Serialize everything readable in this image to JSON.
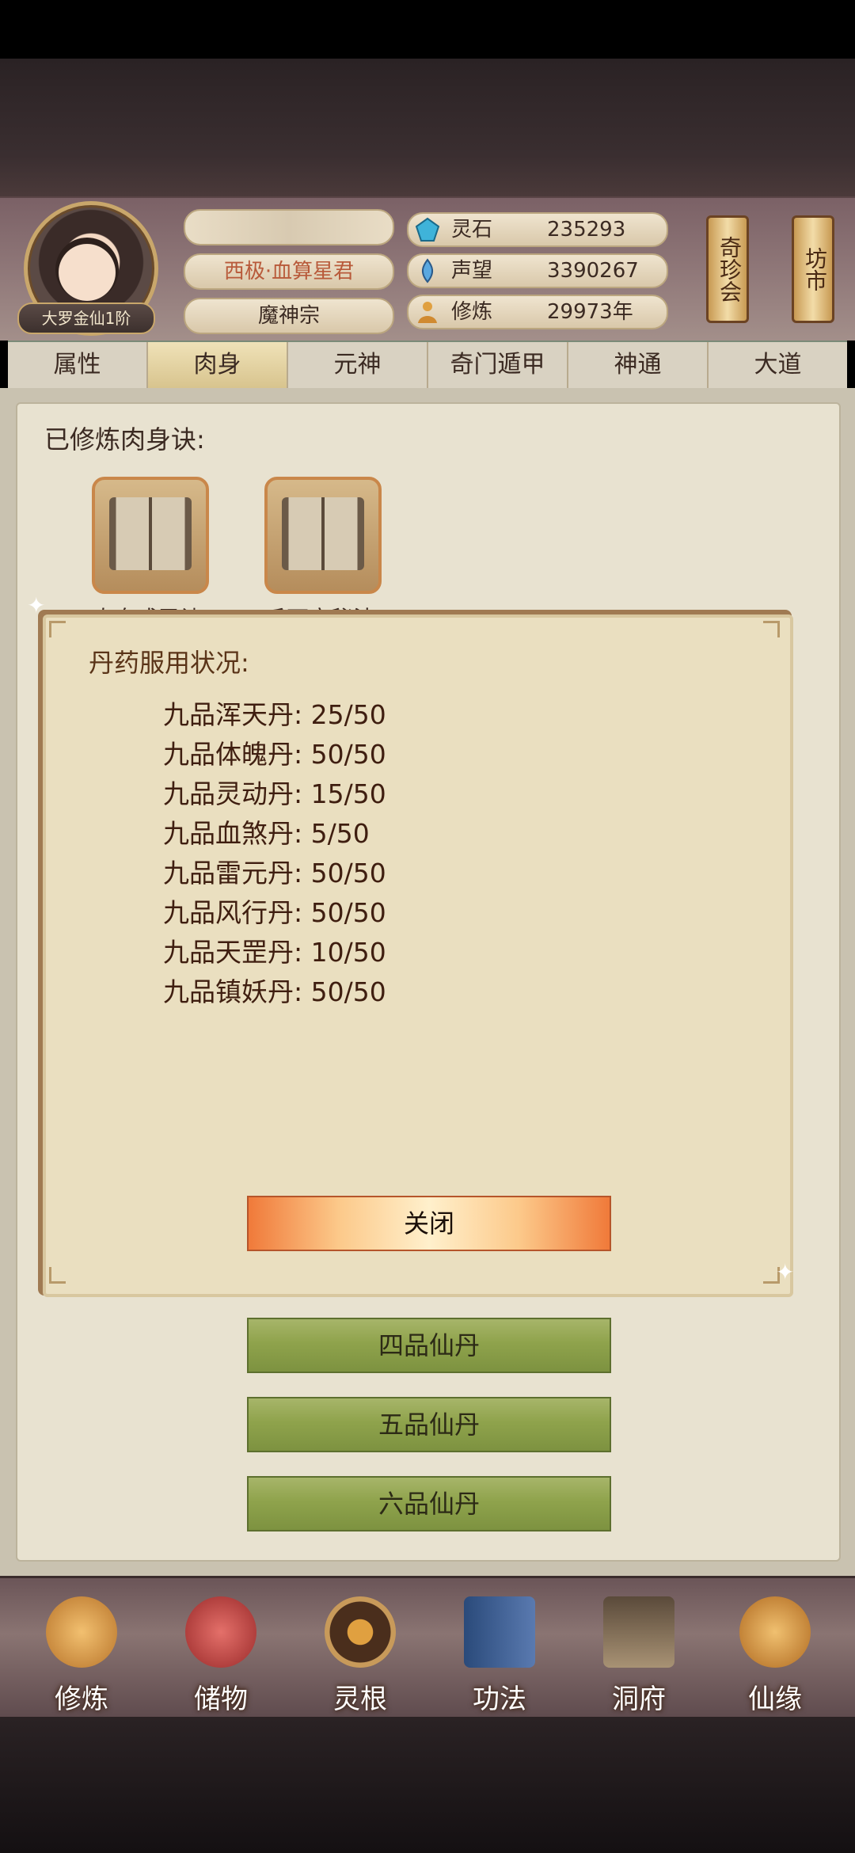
{
  "header": {
    "rank": "大罗金仙1阶",
    "player_name": "",
    "title": "西极·血算星君",
    "sect": "魔神宗",
    "stats": [
      {
        "label": "灵石",
        "value": "235293",
        "icon": "spirit-stone-icon"
      },
      {
        "label": "声望",
        "value": "3390267",
        "icon": "prestige-icon"
      },
      {
        "label": "修炼",
        "value": "29973年",
        "icon": "cultivation-icon"
      }
    ],
    "scroll_buttons": [
      {
        "label": "奇珍会"
      },
      {
        "label": "坊市"
      }
    ]
  },
  "tabs": [
    {
      "label": "属性",
      "active": false
    },
    {
      "label": "肉身",
      "active": true
    },
    {
      "label": "元神",
      "active": false
    },
    {
      "label": "奇门遁甲",
      "active": false
    },
    {
      "label": "神通",
      "active": false
    },
    {
      "label": "大道",
      "active": false
    }
  ],
  "main": {
    "section_title": "已修炼肉身诀:",
    "books": [
      {
        "label": "肉身成圣诀"
      },
      {
        "label": "千面宗秘法"
      }
    ],
    "pill_buttons": [
      {
        "label": "四品仙丹"
      },
      {
        "label": "五品仙丹"
      },
      {
        "label": "六品仙丹"
      }
    ]
  },
  "dialog": {
    "title": "丹药服用状况:",
    "potions": [
      {
        "name": "九品浑天丹",
        "status": "25/50"
      },
      {
        "name": "九品体魄丹",
        "status": "50/50"
      },
      {
        "name": "九品灵动丹",
        "status": "15/50"
      },
      {
        "name": "九品血煞丹",
        "status": "5/50"
      },
      {
        "name": "九品雷元丹",
        "status": "50/50"
      },
      {
        "name": "九品风行丹",
        "status": "50/50"
      },
      {
        "name": "九品天罡丹",
        "status": "10/50"
      },
      {
        "name": "九品镇妖丹",
        "status": "50/50"
      }
    ],
    "close_label": "关闭"
  },
  "bottom_nav": [
    {
      "label": "修炼",
      "icon": "cultivate-icon",
      "color": "#c9893a"
    },
    {
      "label": "储物",
      "icon": "storage-bag-icon",
      "color": "#c4443a"
    },
    {
      "label": "灵根",
      "icon": "spirit-root-icon",
      "color": "#5a3a22"
    },
    {
      "label": "功法",
      "icon": "technique-book-icon",
      "color": "#3c5a8a"
    },
    {
      "label": "洞府",
      "icon": "cave-dwelling-icon",
      "color": "#7a6a5a"
    },
    {
      "label": "仙缘",
      "icon": "gourd-icon",
      "color": "#c98a3a"
    }
  ]
}
